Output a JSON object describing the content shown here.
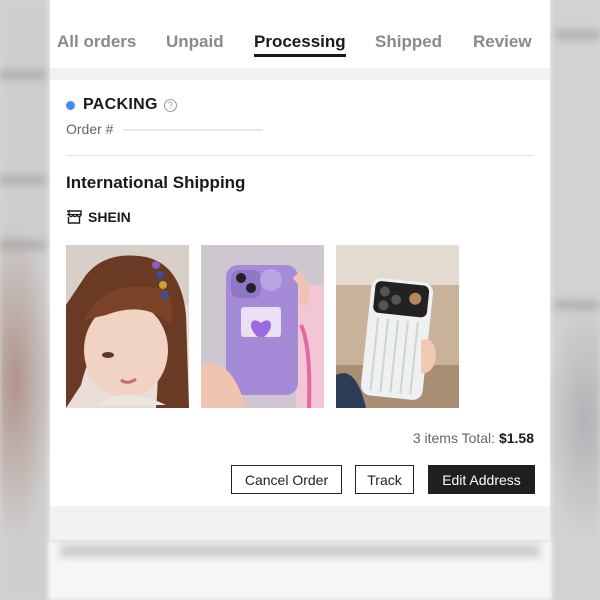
{
  "tabs": [
    {
      "label": "All orders",
      "active": false
    },
    {
      "label": "Unpaid",
      "active": false
    },
    {
      "label": "Processing",
      "active": true
    },
    {
      "label": "Shipped",
      "active": false
    },
    {
      "label": "Review",
      "active": false
    }
  ],
  "order": {
    "status": "PACKING",
    "status_color": "#3f8ff0",
    "order_label": "Order #",
    "shipping_type": "International Shipping",
    "store_name": "SHEIN",
    "items": [
      {
        "name": "hair clip product image"
      },
      {
        "name": "purple heart phone case product image"
      },
      {
        "name": "white phone case product image"
      }
    ],
    "total_prefix": "3 items Total: ",
    "total_value": "$1.58"
  },
  "actions": {
    "cancel_label": "Cancel Order",
    "track_label": "Track",
    "edit_address_label": "Edit Address"
  },
  "icons": {
    "help": "question-circle-icon",
    "store": "store-icon"
  }
}
